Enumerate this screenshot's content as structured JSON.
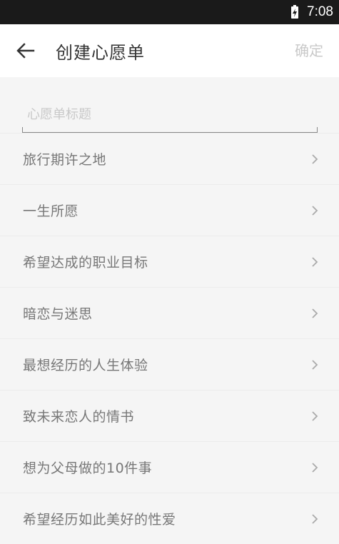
{
  "status_bar": {
    "time": "7:08",
    "battery_icon": "battery-charging-icon"
  },
  "header": {
    "back_icon": "arrow-left-icon",
    "title": "创建心愿单",
    "confirm_label": "确定"
  },
  "form": {
    "title_placeholder": "心愿单标题",
    "title_value": ""
  },
  "templates": [
    {
      "label": "旅行期许之地"
    },
    {
      "label": "一生所愿"
    },
    {
      "label": "希望达成的职业目标"
    },
    {
      "label": "暗恋与迷思"
    },
    {
      "label": "最想经历的人生体验"
    },
    {
      "label": "致未来恋人的情书"
    },
    {
      "label": "想为父母做的10件事"
    },
    {
      "label": "希望经历如此美好的性爱"
    }
  ],
  "colors": {
    "confirm_disabled": "#c9c9c9",
    "item_text": "#777777",
    "background": "#f5f5f5"
  }
}
